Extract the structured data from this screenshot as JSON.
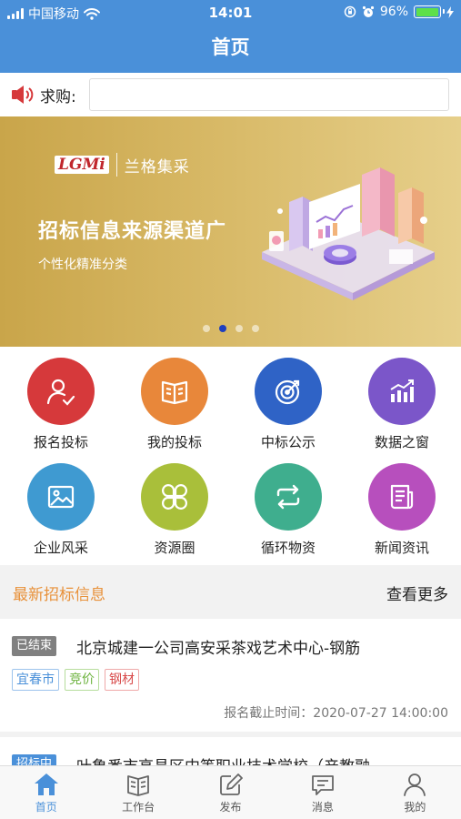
{
  "status_bar": {
    "carrier": "中国移动",
    "time": "14:01",
    "battery": "96%"
  },
  "nav": {
    "title": "首页"
  },
  "search": {
    "label": "求购:",
    "placeholder": ""
  },
  "banner": {
    "logo_mark": "LGMi",
    "logo_name": "兰格集采",
    "title": "招标信息来源渠道广",
    "subtitle": "个性化精准分类",
    "slide_count": 4,
    "active_slide": 1
  },
  "grid": [
    {
      "label": "报名投标",
      "icon": "user-check-icon",
      "color": "#d6393b"
    },
    {
      "label": "我的投标",
      "icon": "book-icon",
      "color": "#e8873a"
    },
    {
      "label": "中标公示",
      "icon": "target-icon",
      "color": "#2f63c6"
    },
    {
      "label": "数据之窗",
      "icon": "bar-chart-icon",
      "color": "#7b56c9"
    },
    {
      "label": "企业风采",
      "icon": "image-icon",
      "color": "#3f9ad1"
    },
    {
      "label": "资源圈",
      "icon": "clover-icon",
      "color": "#a9bf3a"
    },
    {
      "label": "循环物资",
      "icon": "cycle-arrows-icon",
      "color": "#3fae8e"
    },
    {
      "label": "新闻资讯",
      "icon": "news-icon",
      "color": "#b74fbd"
    }
  ],
  "section": {
    "title": "最新招标信息",
    "more": "查看更多"
  },
  "list": [
    {
      "status": "已结束",
      "title": "北京城建一公司高安采茶戏艺术中心-钢筋",
      "tags": [
        {
          "text": "宜春市",
          "color": "#4a90d9"
        },
        {
          "text": "竞价",
          "color": "#6bb23c"
        },
        {
          "text": "钢材",
          "color": "#d84a4a"
        }
      ],
      "deadline": "报名截止时间：2020-07-27 14:00:00"
    },
    {
      "status": "招标中",
      "title": "叶鲁番市高昌区中等职业技术学校（产教融…"
    }
  ],
  "tabs": [
    {
      "label": "首页",
      "icon": "home-icon",
      "active": true
    },
    {
      "label": "工作台",
      "icon": "workbench-icon",
      "active": false
    },
    {
      "label": "发布",
      "icon": "edit-icon",
      "active": false
    },
    {
      "label": "消息",
      "icon": "message-icon",
      "active": false
    },
    {
      "label": "我的",
      "icon": "profile-icon",
      "active": false
    }
  ],
  "colors": {
    "brand": "#4a90d9",
    "accent": "#e8913a",
    "tab_active": "#4a90d9"
  }
}
